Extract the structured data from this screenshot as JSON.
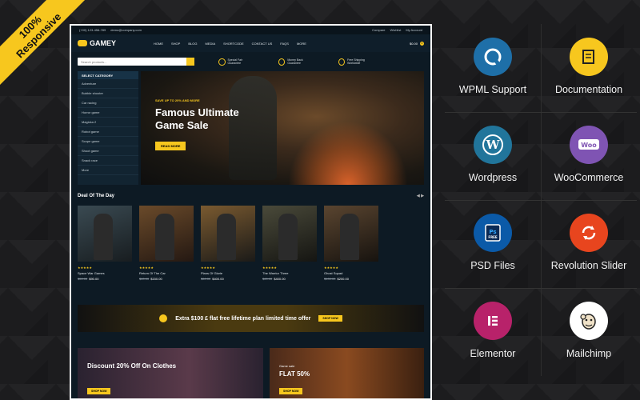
{
  "ribbon": {
    "line1": "100%",
    "line2": "Responsive"
  },
  "site": {
    "topbar": {
      "phone": "(+00) 123-456-789",
      "email": "demo@company.com",
      "compare": "Compare",
      "wishlist": "Wishlist",
      "account": "My Account"
    },
    "logo": "GAMEY",
    "nav": [
      "HOME",
      "SHOP",
      "BLOG",
      "MEDIA",
      "SHORTCODE",
      "CONTACT US",
      "FAQS",
      "MORE"
    ],
    "cart": {
      "total": "$0.00",
      "count": "0"
    },
    "search_placeholder": "Search products...",
    "features": [
      "Special Fair Guarantee",
      "Money Back Guarantee",
      "Free Shipping Worldwide"
    ],
    "category_title": "SELECT CATEGORY",
    "categories": [
      "Adventure",
      "Bubble shooter",
      "Car racing",
      "Horror game",
      "Magicka 2",
      "Robot game",
      "Scope game",
      "Shoot game",
      "Snack race",
      "More"
    ],
    "hero": {
      "subtitle": "SAVE UP TO 20% AND MORE",
      "title": "Famous Ultimate Game Sale",
      "cta": "READ MORE"
    },
    "deal_title": "Deal Of The Day",
    "products": [
      {
        "name": "Space War Games",
        "old": "$50.00",
        "price": "$90.00",
        "rating": 5
      },
      {
        "name": "Return Of The Car",
        "old": "$60.00",
        "price": "$150.00",
        "rating": 5
      },
      {
        "name": "Plans Of Glorie",
        "old": "$60.00",
        "price": "$400.00",
        "rating": 5
      },
      {
        "name": "The Warrior Three",
        "old": "$60.00",
        "price": "$400.00",
        "rating": 5
      },
      {
        "name": "Ghost Squad",
        "old": "$100.00",
        "price": "$200.00",
        "rating": 5
      }
    ],
    "offer": {
      "text": "Extra $100 £ flat free lifetime plan limited time offer",
      "cta": "SHOP NOW"
    },
    "banner1": {
      "title": "Discount 20% Off On Clothes",
      "cta": "SHOP NOW"
    },
    "banner2": {
      "pre": "Game sale",
      "title": "FLAT 50%",
      "cta": "SHOP NOW"
    }
  },
  "features_grid": [
    {
      "label": "WPML Support",
      "icon": "wpml-icon",
      "color": "#1e6fa8"
    },
    {
      "label": "Documentation",
      "icon": "documentation-icon",
      "color": "#f7c71e"
    },
    {
      "label": "Wordpress",
      "icon": "wordpress-icon",
      "color": "#21759b"
    },
    {
      "label": "WooCommerce",
      "icon": "woocommerce-icon",
      "color": "#7f54b3"
    },
    {
      "label": "PSD Files",
      "icon": "psd-icon",
      "color": "#0b5aa8"
    },
    {
      "label": "Revolution Slider",
      "icon": "revolution-slider-icon",
      "color": "#e8451e"
    },
    {
      "label": "Elementor",
      "icon": "elementor-icon",
      "color": "#b8226a"
    },
    {
      "label": "Mailchimp",
      "icon": "mailchimp-icon",
      "color": "#ffffff"
    }
  ],
  "accent": "#f7c71e"
}
